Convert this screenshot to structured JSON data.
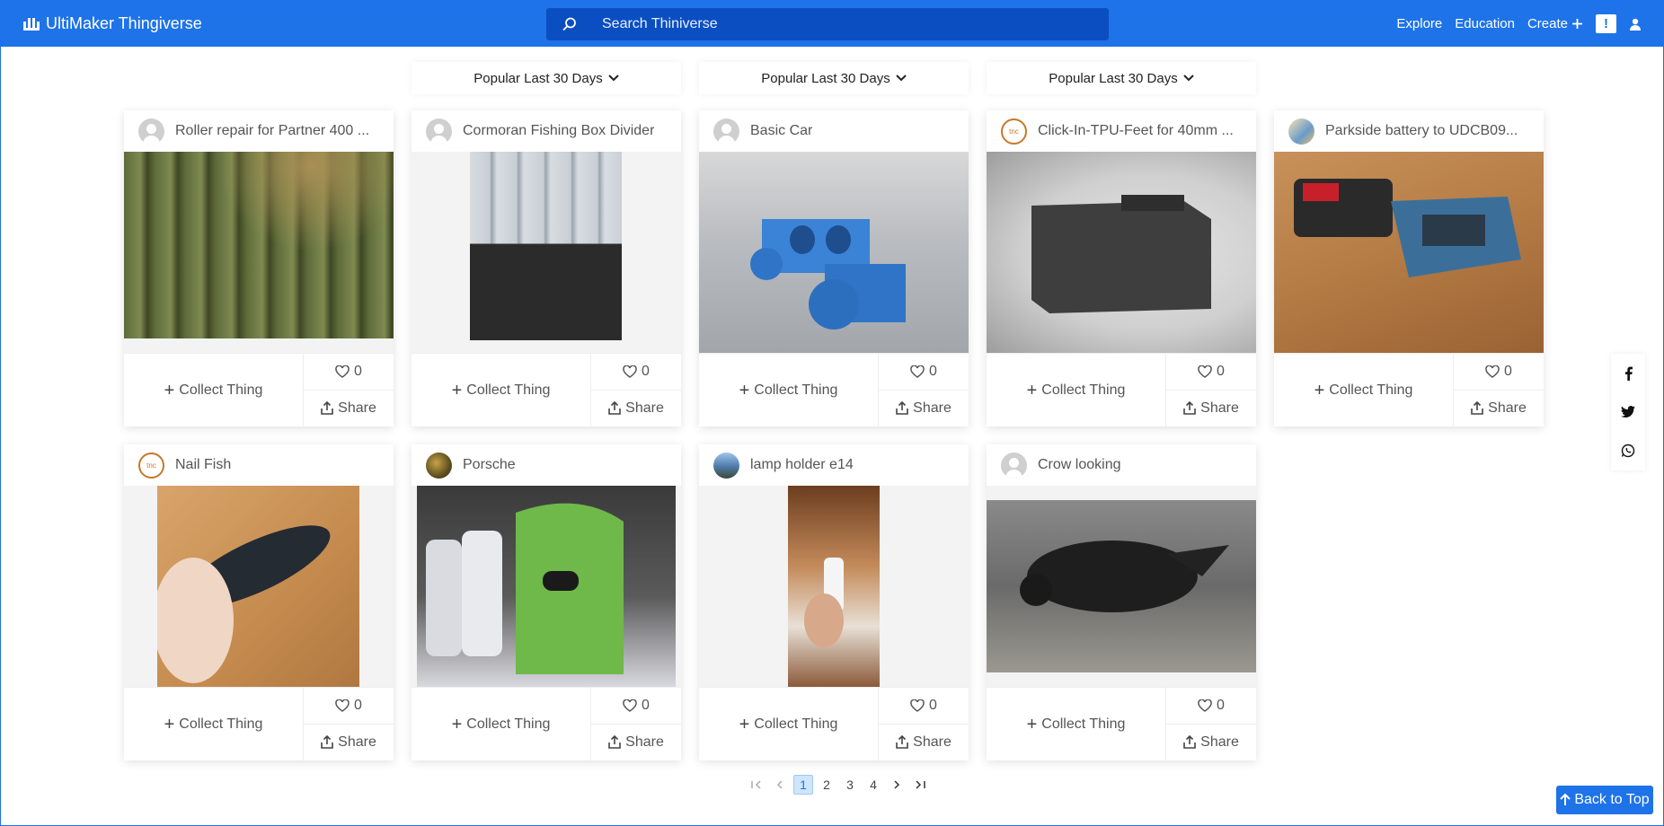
{
  "header": {
    "brand": "UltiMaker Thingiverse",
    "search_placeholder": "Search Thiniverse",
    "nav": {
      "explore": "Explore",
      "education": "Education",
      "create": "Create",
      "notifications": "!"
    }
  },
  "sort_labels": [
    "Popular Last 30 Days",
    "Popular Last 30 Days",
    "Popular Last 30 Days"
  ],
  "collect_label": "Collect Thing",
  "share_label": "Share",
  "cards": [
    {
      "title": "Roller repair for Partner 400 ...",
      "avatar": "user-default",
      "likes": "0",
      "image": "grassy lawnmower roller photo"
    },
    {
      "title": "Cormoran Fishing Box Divider",
      "avatar": "user-default",
      "likes": "0",
      "image": "tackle box with dividers"
    },
    {
      "title": "Basic Car",
      "avatar": "user-default",
      "likes": "0",
      "image": "blue 3D car render"
    },
    {
      "title": "Click-In-TPU-Feet for 40mm ...",
      "avatar": "logo",
      "likes": "0",
      "image": "black printed foot render"
    },
    {
      "title": "Parkside battery to UDCB09...",
      "avatar": "photo",
      "likes": "0",
      "image": "battery adapter on wood table"
    },
    {
      "title": "Nail Fish",
      "avatar": "logo",
      "likes": "0",
      "image": "black fish print in hand"
    },
    {
      "title": "Porsche",
      "avatar": "photo",
      "likes": "0",
      "image": "car front silhouettes"
    },
    {
      "title": "lamp holder e14",
      "avatar": "photo",
      "likes": "0",
      "image": "white lamp holder in hand"
    },
    {
      "title": "Crow looking",
      "avatar": "user-default",
      "likes": "0",
      "image": "blurry crow"
    }
  ],
  "pagination": {
    "pages": [
      "1",
      "2",
      "3",
      "4"
    ],
    "current": "1"
  },
  "back_to_top": "Back to Top",
  "colors": {
    "brand_blue": "#1e73e8",
    "search_bg": "#0b4ec2"
  }
}
